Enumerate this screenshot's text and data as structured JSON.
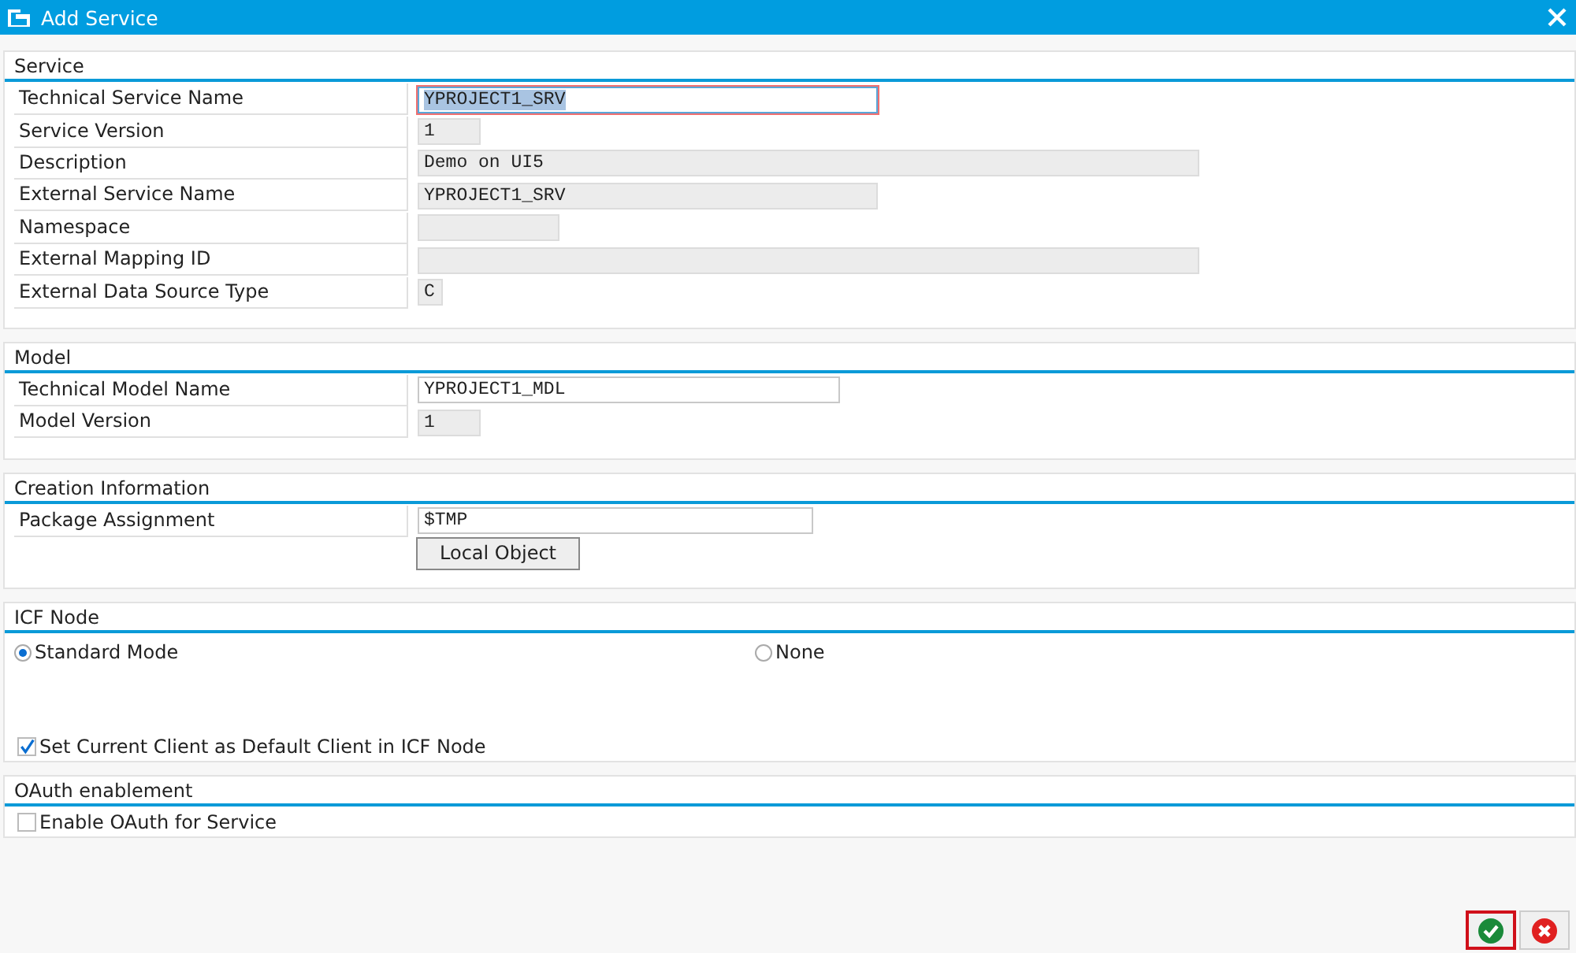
{
  "window": {
    "title": "Add Service"
  },
  "sections": [
    {
      "title": "Service",
      "fields": [
        {
          "label": "Technical Service Name",
          "value": "YPROJECT1_SRV",
          "editable": true,
          "focused": true
        },
        {
          "label": "Service Version",
          "value": "1",
          "editable": false,
          "focused": false
        },
        {
          "label": "Description",
          "value": "Demo on UI5",
          "editable": false,
          "focused": false
        },
        {
          "label": "External Service Name",
          "value": "YPROJECT1_SRV",
          "editable": false,
          "focused": false
        },
        {
          "label": "Namespace",
          "editable": false,
          "focused": false
        },
        {
          "label": "External Mapping ID",
          "editable": false,
          "focused": false
        },
        {
          "label": "External Data Source Type",
          "value": "C",
          "editable": false,
          "focused": false
        }
      ]
    },
    {
      "title": "Model",
      "fields": [
        {
          "label": "Technical Model Name",
          "value": "YPROJECT1_MDL",
          "editable": true,
          "focused": false
        },
        {
          "label": "Model Version",
          "value": "1",
          "editable": false,
          "focused": false
        }
      ]
    },
    {
      "title": "Creation Information",
      "fields": [
        {
          "label": "Package Assignment",
          "value": "$TMP",
          "editable": true,
          "focused": false
        }
      ],
      "button": "Local Object"
    }
  ],
  "icf_node": {
    "title": "ICF Node",
    "radios": [
      {
        "label": "Standard Mode",
        "selected": true
      },
      {
        "label": "None",
        "selected": false
      }
    ],
    "checkbox": {
      "label": "Set Current Client as Default Client in ICF Node",
      "checked": true
    }
  },
  "oauth": {
    "title": "OAuth enablement",
    "checkbox": {
      "label": "Enable OAuth for Service",
      "checked": false
    }
  },
  "footer": {
    "confirm_focused": true
  }
}
